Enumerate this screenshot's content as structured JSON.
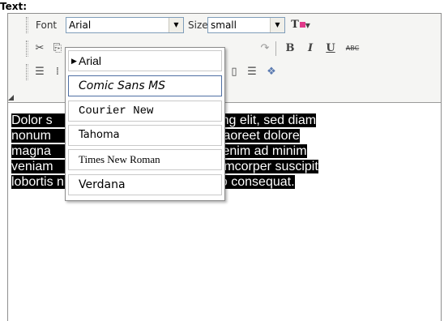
{
  "field_label": "Text:",
  "toolbar": {
    "font_label": "Font",
    "font_value": "Arial",
    "size_label": "Size",
    "size_value": "small",
    "bold_label": "B",
    "italic_label": "I",
    "underline_label": "U",
    "strike_label": "ABC"
  },
  "font_dropdown": {
    "options": [
      {
        "label": "Arial",
        "font": "Arial",
        "selected": true
      },
      {
        "label": "Comic Sans MS",
        "font": "Comic Sans MS",
        "selected": false
      },
      {
        "label": "Courier New",
        "font": "Courier New",
        "selected": false
      },
      {
        "label": "Tahoma",
        "font": "Tahoma",
        "selected": false
      },
      {
        "label": "Times New Roman",
        "font": "Times New Roman",
        "selected": false
      },
      {
        "label": "Verdana",
        "font": "Verdana",
        "selected": false
      }
    ]
  },
  "content": {
    "lines": [
      "Dolor s                                   adipiscing elit, sed diam",
      "nonum                                   dunt ut laoreet dolore",
      "magna                                  . Ut wisi enim ad minim",
      "veniam                                 ation ullamcorper suscipit",
      "lobortis nisl ut aliquip ex ea commodo consequat."
    ]
  },
  "colors": {
    "selection_bg": "#000000",
    "selection_fg": "#ffffff",
    "toolbar_bg": "#f5f5f3",
    "dropdown_border": "#4f6fa3"
  }
}
